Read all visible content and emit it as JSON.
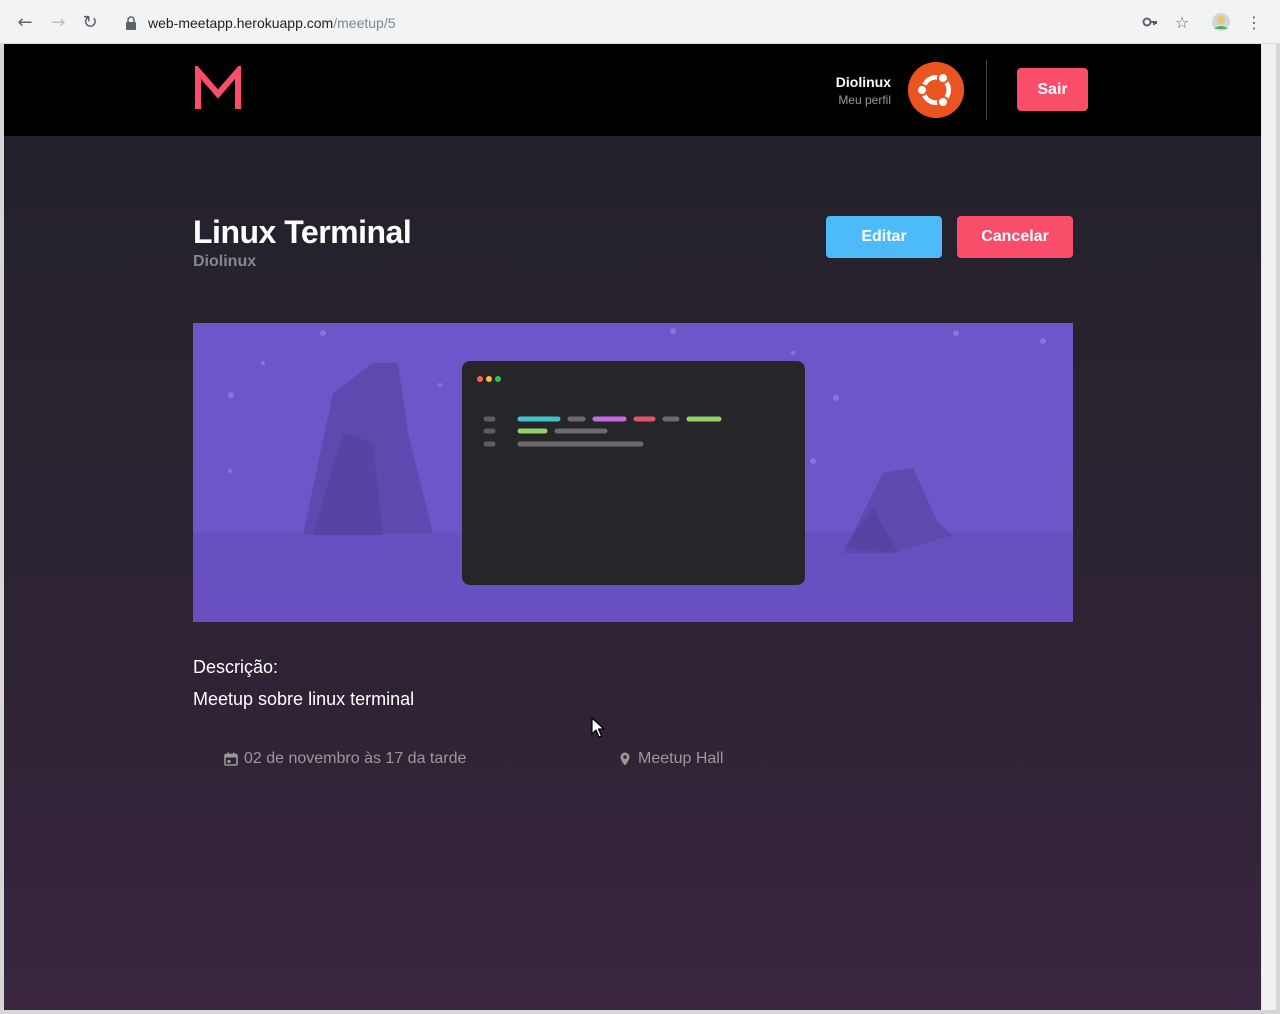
{
  "browser": {
    "url_host": "web-meetapp.herokuapp.com",
    "url_path": "/meetup/5"
  },
  "header": {
    "logo_letter": "M",
    "user_name": "Diolinux",
    "profile_link": "Meu perfil",
    "logout_label": "Sair"
  },
  "meetup": {
    "title": "Linux Terminal",
    "organizer": "Diolinux",
    "edit_label": "Editar",
    "cancel_label": "Cancelar",
    "description_label": "Descrição:",
    "description": "Meetup sobre linux terminal",
    "date": "02 de novembro às 17 da tarde",
    "location": "Meetup Hall"
  },
  "colors": {
    "accent": "#f94d6a",
    "edit": "#4dbaf9",
    "banner": "#6e55c9"
  }
}
